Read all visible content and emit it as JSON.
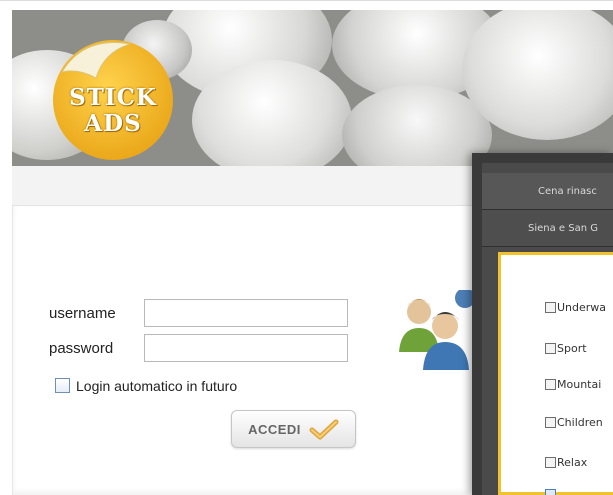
{
  "brand": {
    "logo_line1": "STICK",
    "logo_line2": "ADS",
    "logo_color": "#f3b62a"
  },
  "login": {
    "username_label": "username",
    "password_label": "password",
    "username_value": "",
    "password_value": "",
    "remember_label": "Login automatico in futuro",
    "remember_checked": false,
    "submit_label": "ACCEDI"
  },
  "overlay": {
    "menu_items": [
      {
        "label": "Cena rinasc"
      },
      {
        "label": "Siena e San G"
      }
    ],
    "categories": [
      {
        "label": "Underwa"
      },
      {
        "label": "Sport"
      },
      {
        "label": "Mountai"
      },
      {
        "label": "Children"
      },
      {
        "label": "Relax"
      }
    ],
    "accent_color": "#f2c12e"
  }
}
